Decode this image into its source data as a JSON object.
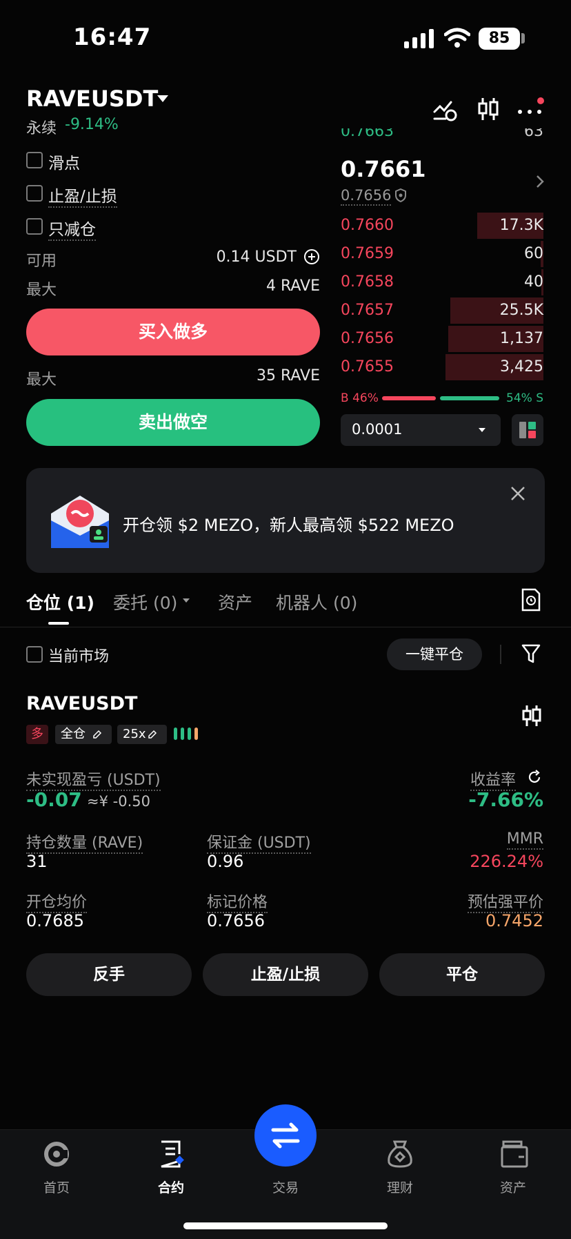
{
  "status_bar": {
    "time": "16:47",
    "battery": "85"
  },
  "header": {
    "pair": "RAVEUSDT",
    "contract_type": "永续",
    "change": "-9.14%"
  },
  "order_form": {
    "options": [
      "滑点",
      "止盈/止损",
      "只减仓"
    ],
    "available_label": "可用",
    "available_value": "0.14 USDT",
    "max_label": "最大",
    "max_buy": "4 RAVE",
    "buy_label": "买入做多",
    "max_sell": "35 RAVE",
    "sell_label": "卖出做空"
  },
  "order_book": {
    "partial_price": "0.7663",
    "partial_qty": "63",
    "last_price": "0.7661",
    "mark_price": "0.7656",
    "asks": [
      {
        "price": "0.7660",
        "qty": "17.3K"
      },
      {
        "price": "0.7659",
        "qty": "60"
      },
      {
        "price": "0.7658",
        "qty": "40"
      },
      {
        "price": "0.7657",
        "qty": "25.5K"
      },
      {
        "price": "0.7656",
        "qty": "1,137"
      },
      {
        "price": "0.7655",
        "qty": "3,425"
      }
    ],
    "buy_ratio": "B 46%",
    "sell_ratio": "54% S",
    "buy_fraction": 0.46,
    "precision": "0.0001"
  },
  "promo": {
    "text": "开仓领 $2 MEZO，新人最高领 $522 MEZO"
  },
  "tabs": [
    {
      "label": "仓位 (1)"
    },
    {
      "label": "委托 (0)"
    },
    {
      "label": "资产"
    },
    {
      "label": "机器人 (0)"
    }
  ],
  "filter_bar": {
    "current_market": "当前市场",
    "close_all": "一键平仓"
  },
  "position": {
    "pair": "RAVEUSDT",
    "side": "多",
    "margin_mode": "全仓",
    "leverage": "25x",
    "upnl_label": "未实现盈亏 (USDT)",
    "upnl_value": "-0.07",
    "upnl_cny": "≈¥ -0.50",
    "roe_label": "收益率",
    "roe_value": "-7.66%",
    "size_label": "持仓数量 (RAVE)",
    "size_value": "31",
    "margin_label": "保证金 (USDT)",
    "margin_value": "0.96",
    "mmr_label": "MMR",
    "mmr_value": "226.24%",
    "entry_label": "开仓均价",
    "entry_value": "0.7685",
    "mark_label": "标记价格",
    "mark_value": "0.7656",
    "liq_label": "预估强平价",
    "liq_value": "0.7452",
    "actions": [
      "反手",
      "止盈/止损",
      "平仓"
    ]
  },
  "bottom_nav": [
    {
      "label": "首页",
      "icon": "home-icon"
    },
    {
      "label": "合约",
      "icon": "futures-icon"
    },
    {
      "label": "交易",
      "icon": "swap-icon"
    },
    {
      "label": "理财",
      "icon": "earn-icon"
    },
    {
      "label": "资产",
      "icon": "wallet-icon"
    }
  ],
  "colors": {
    "buy": "#f75766",
    "sell": "#27c07f",
    "accent": "#1a5cff"
  }
}
